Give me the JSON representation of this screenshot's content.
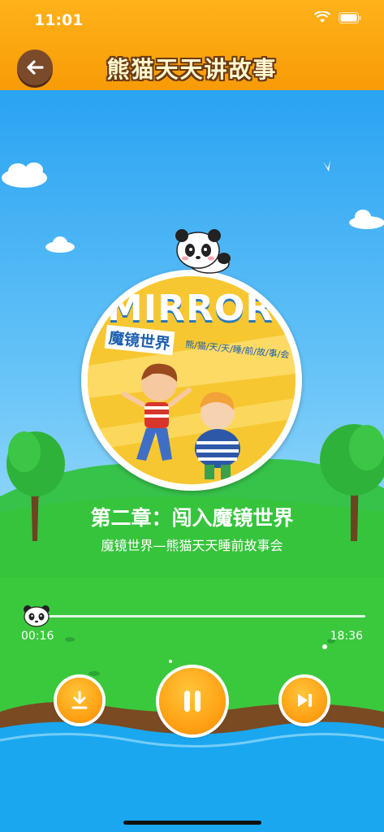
{
  "status_bar": {
    "time": "11:01"
  },
  "header": {
    "title": "熊猫天天讲故事"
  },
  "cover": {
    "word": "MIRROR",
    "subtitle": "魔镜世界",
    "caption": "熊/猫/天/天/睡/前/故/事/会"
  },
  "track": {
    "title": "第二章：闯入魔镜世界",
    "subtitle": "魔镜世界—熊猫天天睡前故事会"
  },
  "player": {
    "current_time": "00:16",
    "total_time": "18:36",
    "progress": 0.0145
  },
  "colors": {
    "header": "#f7a10b",
    "button": "#ff9d10",
    "grass": "#34c43a",
    "water": "#1aa7f0"
  }
}
